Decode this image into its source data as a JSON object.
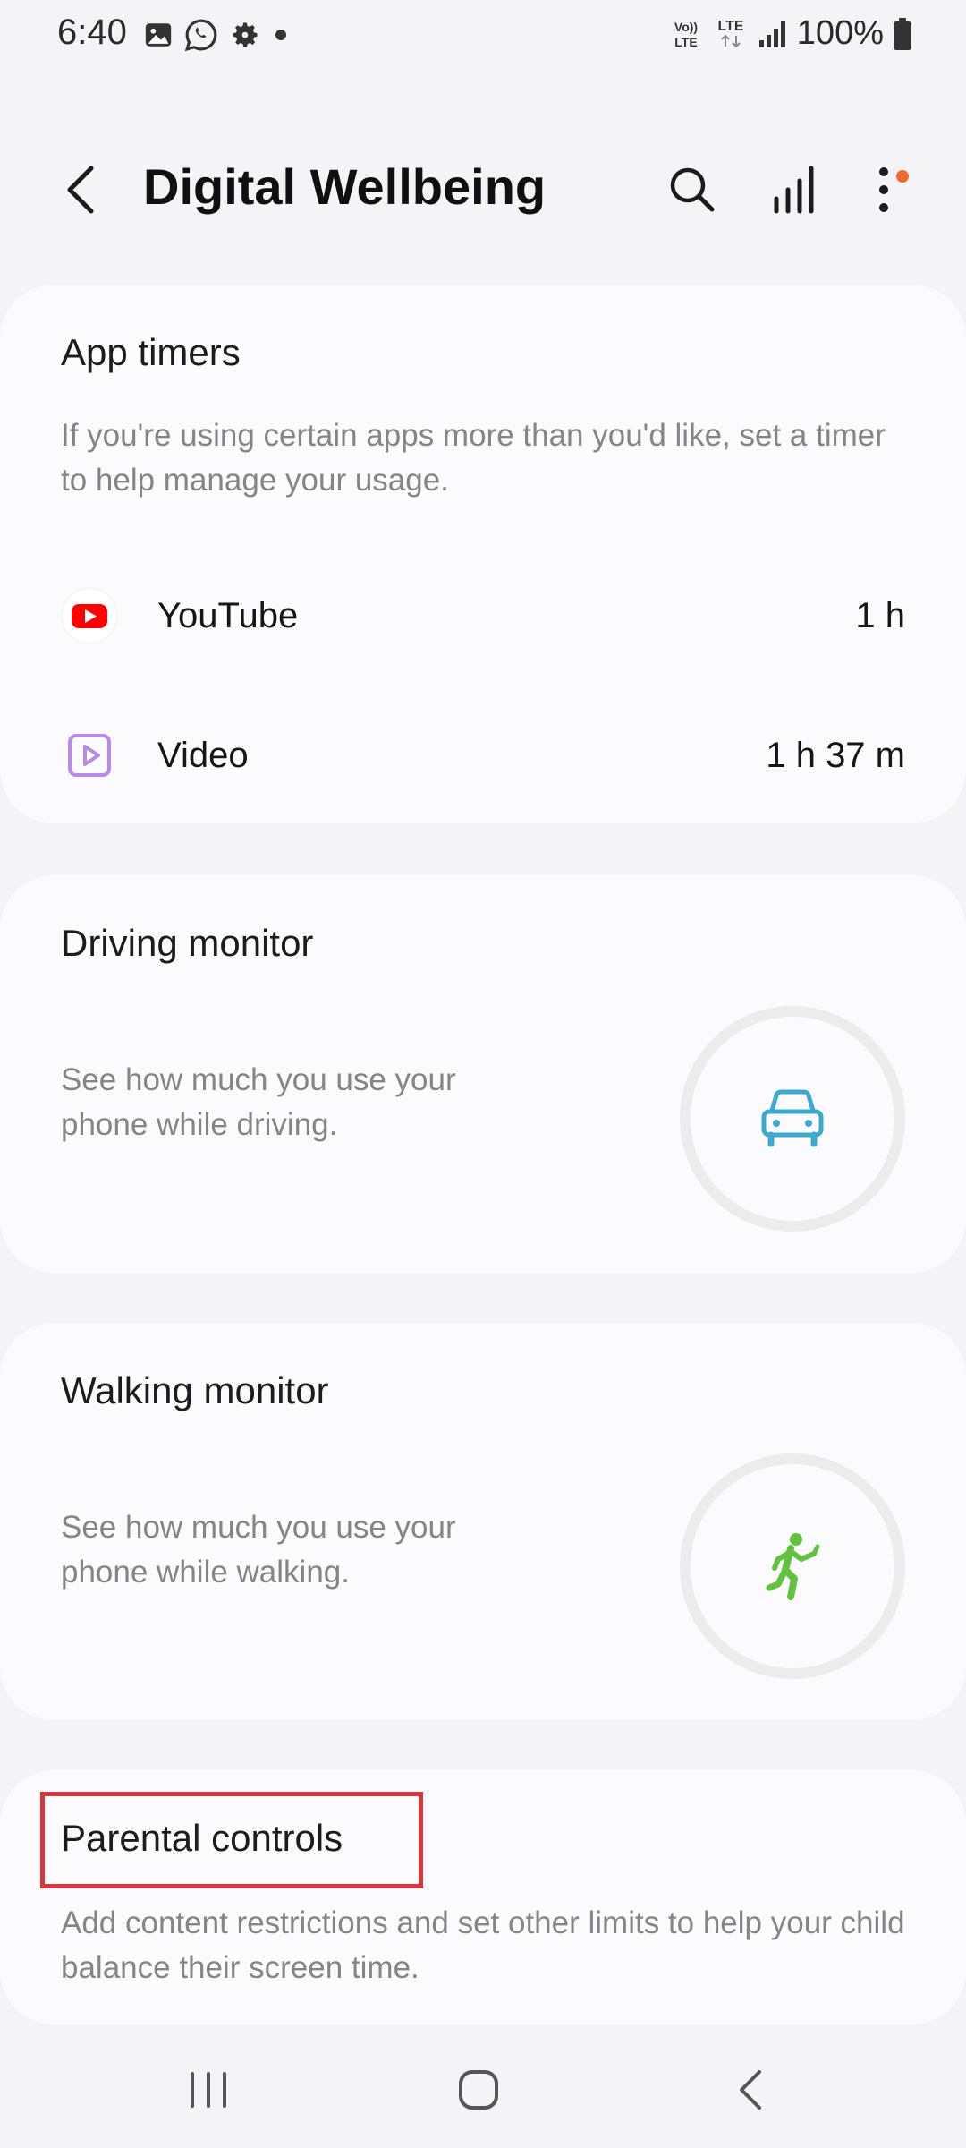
{
  "status_bar": {
    "time": "6:40",
    "battery": "100%",
    "network_top": "Vo)) LTE",
    "lte_label": "LTE"
  },
  "header": {
    "title": "Digital Wellbeing"
  },
  "app_timers": {
    "title": "App timers",
    "description": "If you're using certain apps more than you'd like, set a timer to help manage your usage.",
    "apps": [
      {
        "name": "YouTube",
        "time": "1 h",
        "icon": "youtube-icon"
      },
      {
        "name": "Video",
        "time": "1 h 37 m",
        "icon": "video-player-icon"
      }
    ]
  },
  "driving_monitor": {
    "title": "Driving monitor",
    "description": "See how much you use your phone while driving.",
    "icon": "car-icon"
  },
  "walking_monitor": {
    "title": "Walking monitor",
    "description": "See how much you use your phone while walking.",
    "icon": "walking-person-icon"
  },
  "parental_controls": {
    "title": "Parental controls",
    "description": "Add content restrictions and set other limits to help your child balance their screen time."
  },
  "colors": {
    "youtube_red": "#ff0000",
    "video_purple": "#b88be6",
    "car_blue": "#3ba9d0",
    "walk_green": "#62c23f",
    "notification_dot": "#ef6a2f",
    "highlight_red": "#d9363e"
  }
}
